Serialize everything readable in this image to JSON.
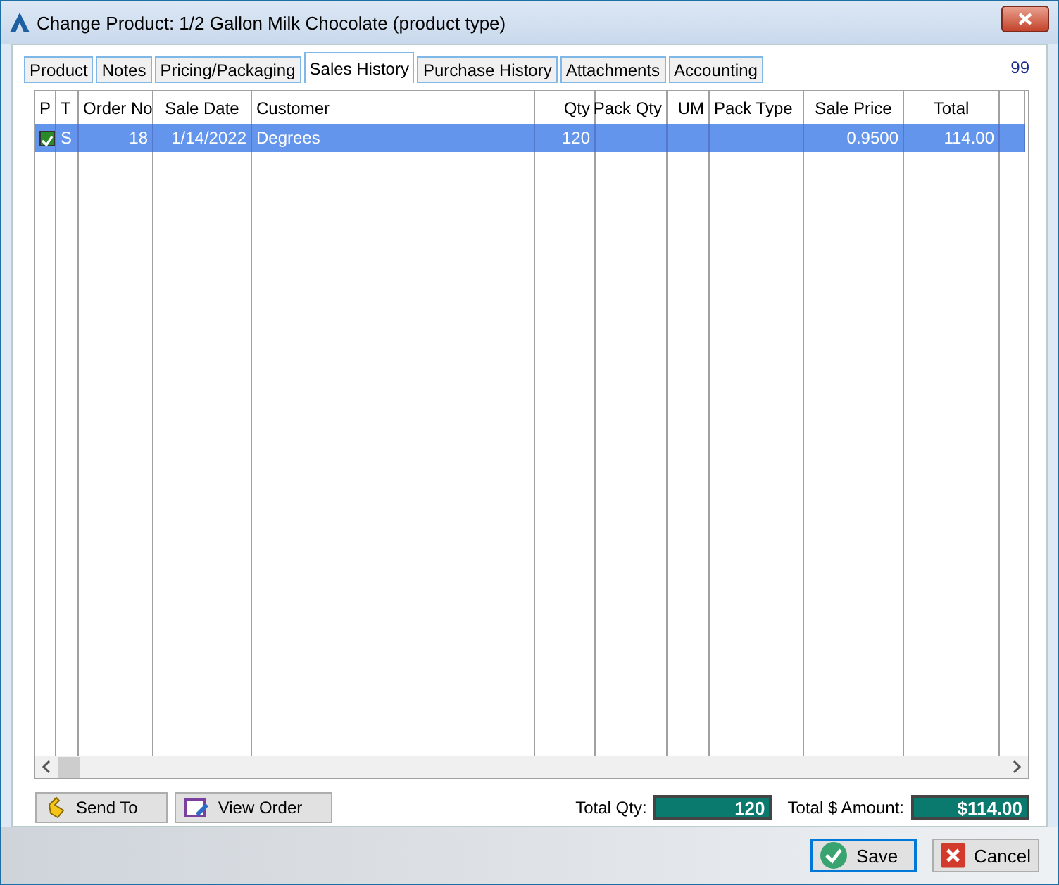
{
  "window": {
    "title": "Change Product: 1/2 Gallon Milk Chocolate (product type)"
  },
  "tabs": [
    {
      "label": "Product",
      "selected": false
    },
    {
      "label": "Notes",
      "selected": false
    },
    {
      "label": "Pricing/Packaging",
      "selected": false
    },
    {
      "label": "Sales History",
      "selected": true
    },
    {
      "label": "Purchase History",
      "selected": false
    },
    {
      "label": "Attachments",
      "selected": false
    },
    {
      "label": "Accounting",
      "selected": false
    }
  ],
  "record_number": "99",
  "table": {
    "columns": [
      "P",
      "T",
      "Order No",
      "Sale Date",
      "Customer",
      "Qty",
      "Pack Qty",
      "UM",
      "Pack Type",
      "Sale Price",
      "Total"
    ],
    "rows": [
      {
        "selected": true,
        "posted": true,
        "cells": [
          "",
          "S",
          "18",
          "1/14/2022",
          "Degrees",
          "120",
          "",
          "",
          "",
          "0.9500",
          "114.00"
        ]
      }
    ]
  },
  "actions": [
    {
      "kind": "send",
      "label": "Send To"
    },
    {
      "kind": "view",
      "label": "View Order"
    }
  ],
  "totals": [
    {
      "label": "Total Qty:",
      "value": "120"
    },
    {
      "label": "Total $ Amount:",
      "value": "$114.00"
    }
  ],
  "buttons": [
    {
      "kind": "save",
      "label": "Save",
      "focused": true
    },
    {
      "kind": "cancel",
      "label": "Cancel",
      "focused": false
    }
  ]
}
